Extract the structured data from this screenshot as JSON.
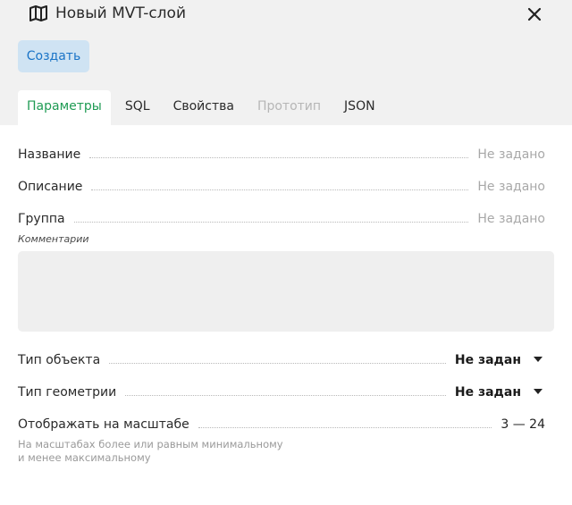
{
  "dialog": {
    "title": "Новый MVT-слой",
    "create_label": "Создать"
  },
  "tabs": [
    {
      "label": "Параметры"
    },
    {
      "label": "SQL"
    },
    {
      "label": "Свойства"
    },
    {
      "label": "Прототип"
    },
    {
      "label": "JSON"
    }
  ],
  "fields": {
    "name": {
      "label": "Название",
      "value": "Не задано"
    },
    "description": {
      "label": "Описание",
      "value": "Не задано"
    },
    "group": {
      "label": "Группа",
      "value": "Не задано"
    },
    "comments": {
      "label": "Комментарии",
      "value": ""
    },
    "object_type": {
      "label": "Тип объекта",
      "value": "Не задан"
    },
    "geometry_type": {
      "label": "Тип геометрии",
      "value": "Не задан"
    },
    "scale": {
      "label": "Отображать на масштабе",
      "value": "3 — 24",
      "hint": "На масштабах более или равным минимальному и менее максимальному"
    }
  },
  "colors": {
    "accent_active_tab": "#1f9b54",
    "button_bg": "#cfe3f3",
    "button_text": "#1a74c7"
  },
  "icons": {
    "title": "map-icon",
    "close": "close-icon",
    "select": "chevron-down-icon"
  }
}
